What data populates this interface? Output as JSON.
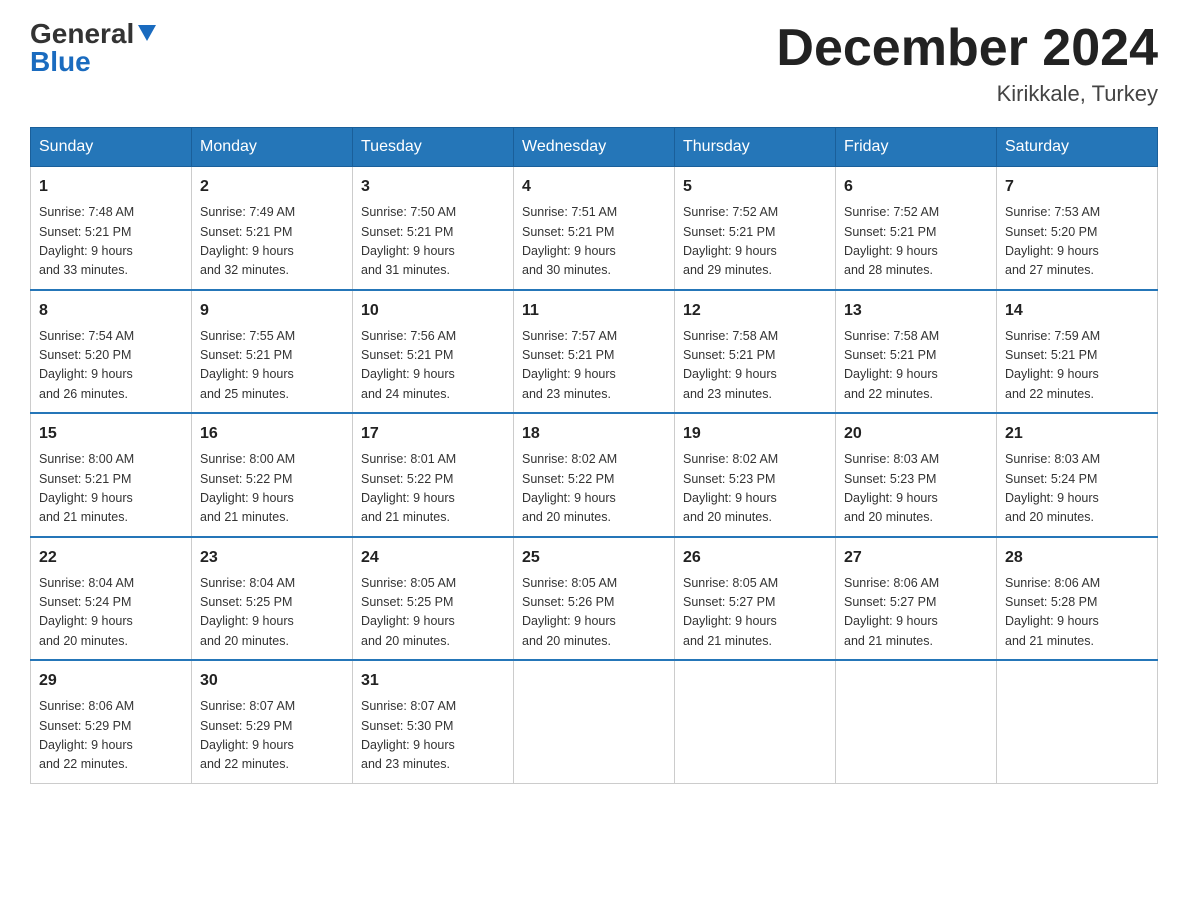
{
  "logo": {
    "general": "General",
    "blue": "Blue"
  },
  "title": "December 2024",
  "location": "Kirikkale, Turkey",
  "days_of_week": [
    "Sunday",
    "Monday",
    "Tuesday",
    "Wednesday",
    "Thursday",
    "Friday",
    "Saturday"
  ],
  "weeks": [
    [
      {
        "day": "1",
        "sunrise": "7:48 AM",
        "sunset": "5:21 PM",
        "daylight": "9 hours and 33 minutes."
      },
      {
        "day": "2",
        "sunrise": "7:49 AM",
        "sunset": "5:21 PM",
        "daylight": "9 hours and 32 minutes."
      },
      {
        "day": "3",
        "sunrise": "7:50 AM",
        "sunset": "5:21 PM",
        "daylight": "9 hours and 31 minutes."
      },
      {
        "day": "4",
        "sunrise": "7:51 AM",
        "sunset": "5:21 PM",
        "daylight": "9 hours and 30 minutes."
      },
      {
        "day": "5",
        "sunrise": "7:52 AM",
        "sunset": "5:21 PM",
        "daylight": "9 hours and 29 minutes."
      },
      {
        "day": "6",
        "sunrise": "7:52 AM",
        "sunset": "5:21 PM",
        "daylight": "9 hours and 28 minutes."
      },
      {
        "day": "7",
        "sunrise": "7:53 AM",
        "sunset": "5:20 PM",
        "daylight": "9 hours and 27 minutes."
      }
    ],
    [
      {
        "day": "8",
        "sunrise": "7:54 AM",
        "sunset": "5:20 PM",
        "daylight": "9 hours and 26 minutes."
      },
      {
        "day": "9",
        "sunrise": "7:55 AM",
        "sunset": "5:21 PM",
        "daylight": "9 hours and 25 minutes."
      },
      {
        "day": "10",
        "sunrise": "7:56 AM",
        "sunset": "5:21 PM",
        "daylight": "9 hours and 24 minutes."
      },
      {
        "day": "11",
        "sunrise": "7:57 AM",
        "sunset": "5:21 PM",
        "daylight": "9 hours and 23 minutes."
      },
      {
        "day": "12",
        "sunrise": "7:58 AM",
        "sunset": "5:21 PM",
        "daylight": "9 hours and 23 minutes."
      },
      {
        "day": "13",
        "sunrise": "7:58 AM",
        "sunset": "5:21 PM",
        "daylight": "9 hours and 22 minutes."
      },
      {
        "day": "14",
        "sunrise": "7:59 AM",
        "sunset": "5:21 PM",
        "daylight": "9 hours and 22 minutes."
      }
    ],
    [
      {
        "day": "15",
        "sunrise": "8:00 AM",
        "sunset": "5:21 PM",
        "daylight": "9 hours and 21 minutes."
      },
      {
        "day": "16",
        "sunrise": "8:00 AM",
        "sunset": "5:22 PM",
        "daylight": "9 hours and 21 minutes."
      },
      {
        "day": "17",
        "sunrise": "8:01 AM",
        "sunset": "5:22 PM",
        "daylight": "9 hours and 21 minutes."
      },
      {
        "day": "18",
        "sunrise": "8:02 AM",
        "sunset": "5:22 PM",
        "daylight": "9 hours and 20 minutes."
      },
      {
        "day": "19",
        "sunrise": "8:02 AM",
        "sunset": "5:23 PM",
        "daylight": "9 hours and 20 minutes."
      },
      {
        "day": "20",
        "sunrise": "8:03 AM",
        "sunset": "5:23 PM",
        "daylight": "9 hours and 20 minutes."
      },
      {
        "day": "21",
        "sunrise": "8:03 AM",
        "sunset": "5:24 PM",
        "daylight": "9 hours and 20 minutes."
      }
    ],
    [
      {
        "day": "22",
        "sunrise": "8:04 AM",
        "sunset": "5:24 PM",
        "daylight": "9 hours and 20 minutes."
      },
      {
        "day": "23",
        "sunrise": "8:04 AM",
        "sunset": "5:25 PM",
        "daylight": "9 hours and 20 minutes."
      },
      {
        "day": "24",
        "sunrise": "8:05 AM",
        "sunset": "5:25 PM",
        "daylight": "9 hours and 20 minutes."
      },
      {
        "day": "25",
        "sunrise": "8:05 AM",
        "sunset": "5:26 PM",
        "daylight": "9 hours and 20 minutes."
      },
      {
        "day": "26",
        "sunrise": "8:05 AM",
        "sunset": "5:27 PM",
        "daylight": "9 hours and 21 minutes."
      },
      {
        "day": "27",
        "sunrise": "8:06 AM",
        "sunset": "5:27 PM",
        "daylight": "9 hours and 21 minutes."
      },
      {
        "day": "28",
        "sunrise": "8:06 AM",
        "sunset": "5:28 PM",
        "daylight": "9 hours and 21 minutes."
      }
    ],
    [
      {
        "day": "29",
        "sunrise": "8:06 AM",
        "sunset": "5:29 PM",
        "daylight": "9 hours and 22 minutes."
      },
      {
        "day": "30",
        "sunrise": "8:07 AM",
        "sunset": "5:29 PM",
        "daylight": "9 hours and 22 minutes."
      },
      {
        "day": "31",
        "sunrise": "8:07 AM",
        "sunset": "5:30 PM",
        "daylight": "9 hours and 23 minutes."
      },
      null,
      null,
      null,
      null
    ]
  ],
  "labels": {
    "sunrise": "Sunrise: ",
    "sunset": "Sunset: ",
    "daylight": "Daylight: "
  }
}
